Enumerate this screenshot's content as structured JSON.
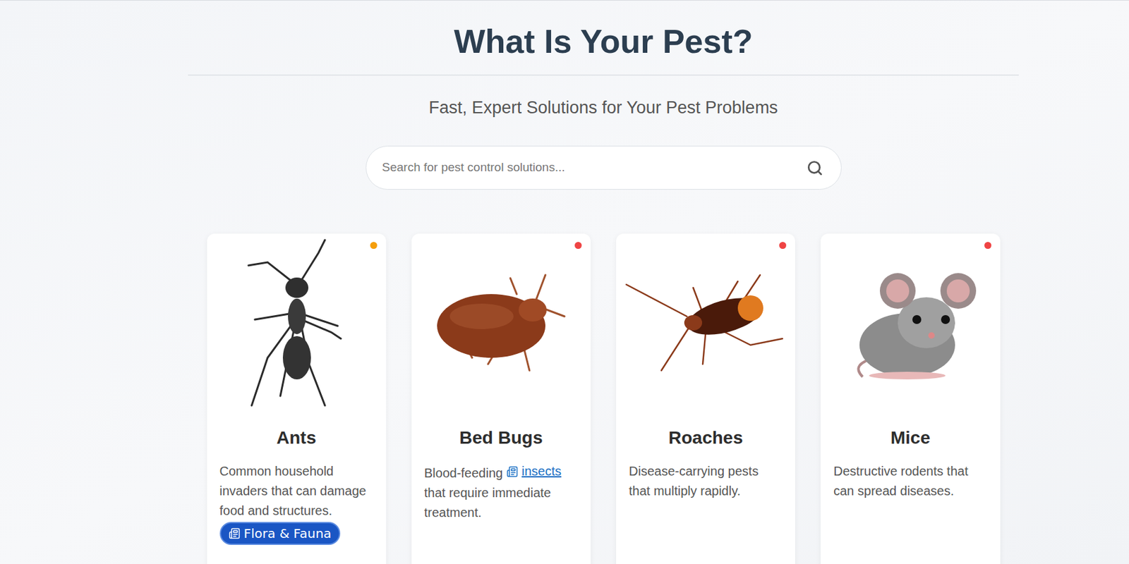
{
  "header": {
    "title": "What Is Your Pest?",
    "subtitle": "Fast, Expert Solutions for Your Pest Problems"
  },
  "search": {
    "placeholder": "Search for pest control solutions..."
  },
  "pests": [
    {
      "name": "Ants",
      "kind": "ant",
      "color": "#f59e0b",
      "description": [
        {
          "kind": "text",
          "text": "Common household invaders that can damage food and structures."
        }
      ],
      "badge": "Flora & Fauna"
    },
    {
      "name": "Bed Bugs",
      "kind": "bedbug",
      "color": "#ef4444",
      "description": [
        {
          "kind": "text",
          "text": "Blood-feeding "
        },
        {
          "kind": "link",
          "text": "insects"
        },
        {
          "kind": "text",
          "text": " that require immediate treatment."
        }
      ]
    },
    {
      "name": "Roaches",
      "kind": "roach",
      "color": "#ef4444",
      "description": [
        {
          "kind": "text",
          "text": "Disease-carrying pests that multiply rapidly."
        }
      ]
    },
    {
      "name": "Mice",
      "kind": "mouse",
      "color": "#ef4444",
      "description": [
        {
          "kind": "text",
          "text": "Destructive rodents that can spread diseases."
        }
      ]
    }
  ]
}
